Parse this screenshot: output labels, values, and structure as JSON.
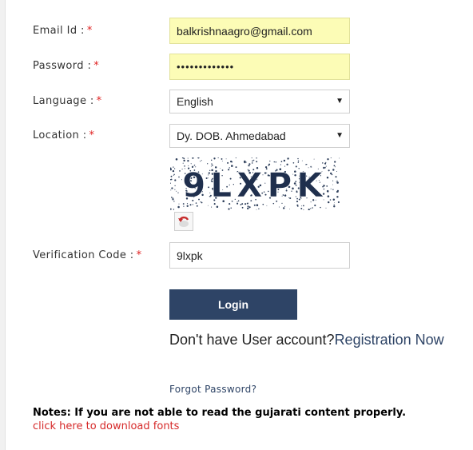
{
  "form": {
    "email": {
      "label": "Email Id :",
      "required": "*",
      "value": "balkrishnaagro@gmail.com"
    },
    "password": {
      "label": "Password :",
      "required": "*",
      "value": "•••••••••••••"
    },
    "language": {
      "label": "Language :",
      "required": "*",
      "selected": "English"
    },
    "location": {
      "label": "Location :",
      "required": "*",
      "selected": "Dy. DOB. Ahmedabad"
    },
    "captcha": {
      "text": "9LXPK"
    },
    "verification": {
      "label": "Verification Code :",
      "required": "*",
      "value": "9lxpk"
    }
  },
  "actions": {
    "login_label": "Login",
    "no_account_text": "Don't have User account?",
    "registration_link": "Registration Now",
    "forgot_password": "Forgot Password?"
  },
  "notes": {
    "text": "Notes: If you are not able to read the gujarati content properly.",
    "download_link": "click here to download fonts"
  },
  "icons": {
    "select_arrow": "chevron-down-icon",
    "refresh": "refresh-captcha-icon"
  },
  "colors": {
    "button_bg": "#2e4466",
    "required": "#e02020",
    "filled_input": "#fcfcb6",
    "link_red": "#d62a2a"
  }
}
